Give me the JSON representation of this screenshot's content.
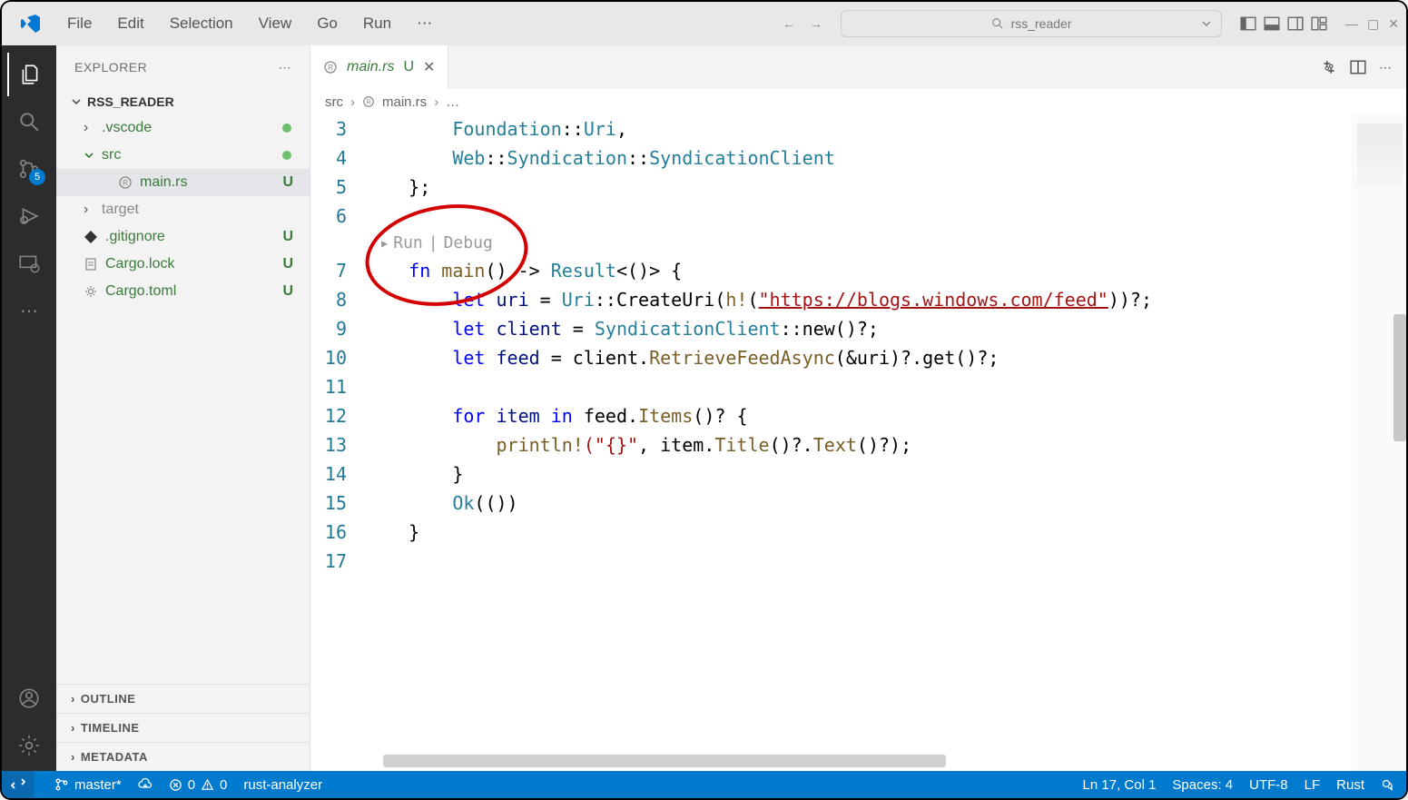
{
  "titlebar": {
    "menu": [
      "File",
      "Edit",
      "Selection",
      "View",
      "Go",
      "Run"
    ],
    "search_text": "rss_reader"
  },
  "sidebar": {
    "title": "EXPLORER",
    "project": "RSS_READER",
    "tree": {
      "vscode": ".vscode",
      "src": "src",
      "mainrs": "main.rs",
      "target": "target",
      "gitignore": ".gitignore",
      "cargolock": "Cargo.lock",
      "cargotoml": "Cargo.toml"
    },
    "badges": {
      "mainrs": "U",
      "gitignore": "U",
      "cargolock": "U",
      "cargotoml": "U"
    },
    "sections": [
      "OUTLINE",
      "TIMELINE",
      "METADATA"
    ]
  },
  "activitybar": {
    "badge_scm": "5"
  },
  "editor": {
    "tab_name": "main.rs",
    "tab_modified": "U",
    "breadcrumb": {
      "folder": "src",
      "file": "main.rs",
      "trail": "…"
    },
    "codelens": {
      "run": "Run",
      "debug": "Debug"
    },
    "lines": {
      "3": {
        "n": "3",
        "content": "        Foundation::Uri,"
      },
      "4": {
        "n": "4"
      },
      "5": {
        "n": "5",
        "content": "    };"
      },
      "6": {
        "n": "6",
        "content": ""
      },
      "7": {
        "n": "7"
      },
      "8": {
        "n": "8"
      },
      "9": {
        "n": "9"
      },
      "10": {
        "n": "10"
      },
      "11": {
        "n": "11",
        "content": ""
      },
      "12": {
        "n": "12"
      },
      "13": {
        "n": "13"
      },
      "14": {
        "n": "14",
        "content": "        }"
      },
      "15": {
        "n": "15"
      },
      "16": {
        "n": "16",
        "content": "    }"
      },
      "17": {
        "n": "17",
        "content": ""
      }
    },
    "tokens": {
      "Foundation": "Foundation",
      "Uri": "Uri",
      "Web": "Web",
      "Syndication": "Syndication",
      "SyndicationClient": "SyndicationClient",
      "fn": "fn ",
      "main": "main",
      "arrow": "() -> ",
      "Result": "Result",
      "resT": "<()> {",
      "let": "let ",
      "uri": "uri",
      "eq": " = ",
      "UriT": "Uri",
      "CreateUri": "::CreateUri(",
      "h": "h!",
      "url": "\"https://blogs.windows.com/feed\"",
      "closeCreate": "))?;",
      "client": "client",
      "SynC": "SyndicationClient",
      "new": "::new()?;",
      "feed": "feed",
      "dot": " = client.",
      "RetrieveFeedAsync": "RetrieveFeedAsync",
      "args": "(&uri)?.get()?;",
      "for": "for ",
      "item": "item",
      "in": " in ",
      "feed2": "feed.",
      "Items": "Items",
      "paren": "()? {",
      "println": "println!",
      "fmt": "(\"{}\"",
      "comma": ", item.",
      "Title": "Title",
      "q1": "()?.",
      "Text": "Text",
      "q2": "()?);",
      "Ok": "Ok",
      "okArg": "(())"
    }
  },
  "statusbar": {
    "branch": "master*",
    "errors": "0",
    "warnings": "0",
    "lsp": "rust-analyzer",
    "position": "Ln 17, Col 1",
    "spaces": "Spaces: 4",
    "encoding": "UTF-8",
    "eol": "LF",
    "lang": "Rust"
  }
}
